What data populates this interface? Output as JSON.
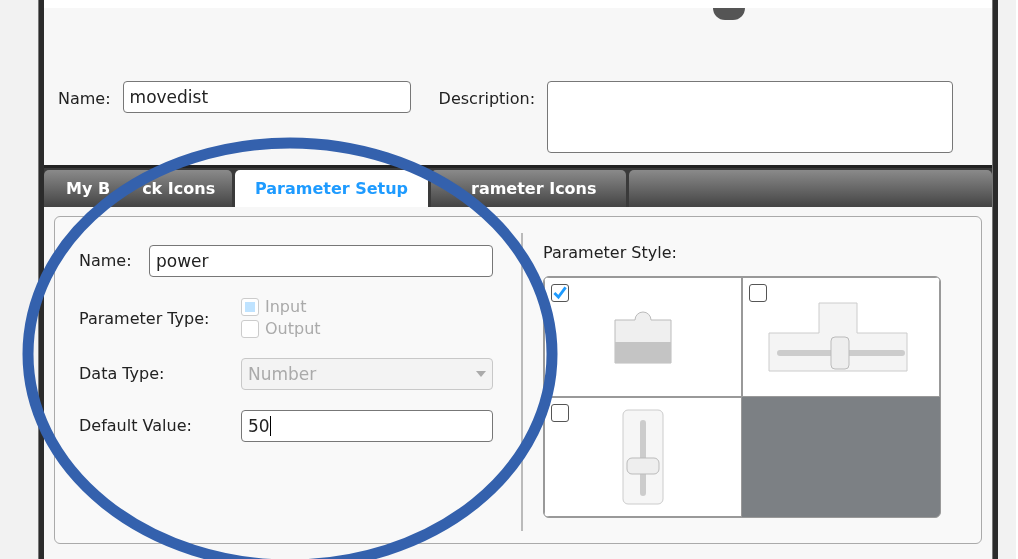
{
  "block": {
    "name": {
      "label": "Name:",
      "value": "movedist"
    },
    "description": {
      "label": "Description:"
    }
  },
  "tabs": [
    {
      "label_parts": [
        "My B",
        "ck Icons"
      ],
      "selected": false
    },
    {
      "label_parts": [
        "Parameter Setup"
      ],
      "selected": true
    },
    {
      "label_parts": [
        "rameter Icons"
      ],
      "selected": false
    }
  ],
  "parameter": {
    "name": {
      "label": "Name:",
      "value": "power"
    },
    "parameter_type": {
      "label": "Parameter Type:",
      "disabled": true,
      "options": [
        {
          "label": "Input",
          "checked": true
        },
        {
          "label": "Output",
          "checked": false
        }
      ]
    },
    "data_type": {
      "label": "Data Type:",
      "value": "Number",
      "disabled": true
    },
    "default_value": {
      "label": "Default Value:",
      "value": "50"
    }
  },
  "parameter_style": {
    "label": "Parameter Style:",
    "options": [
      {
        "kind": "block",
        "checked": true
      },
      {
        "kind": "horizontal-slider",
        "checked": false
      },
      {
        "kind": "vertical-slider",
        "checked": false
      }
    ]
  }
}
